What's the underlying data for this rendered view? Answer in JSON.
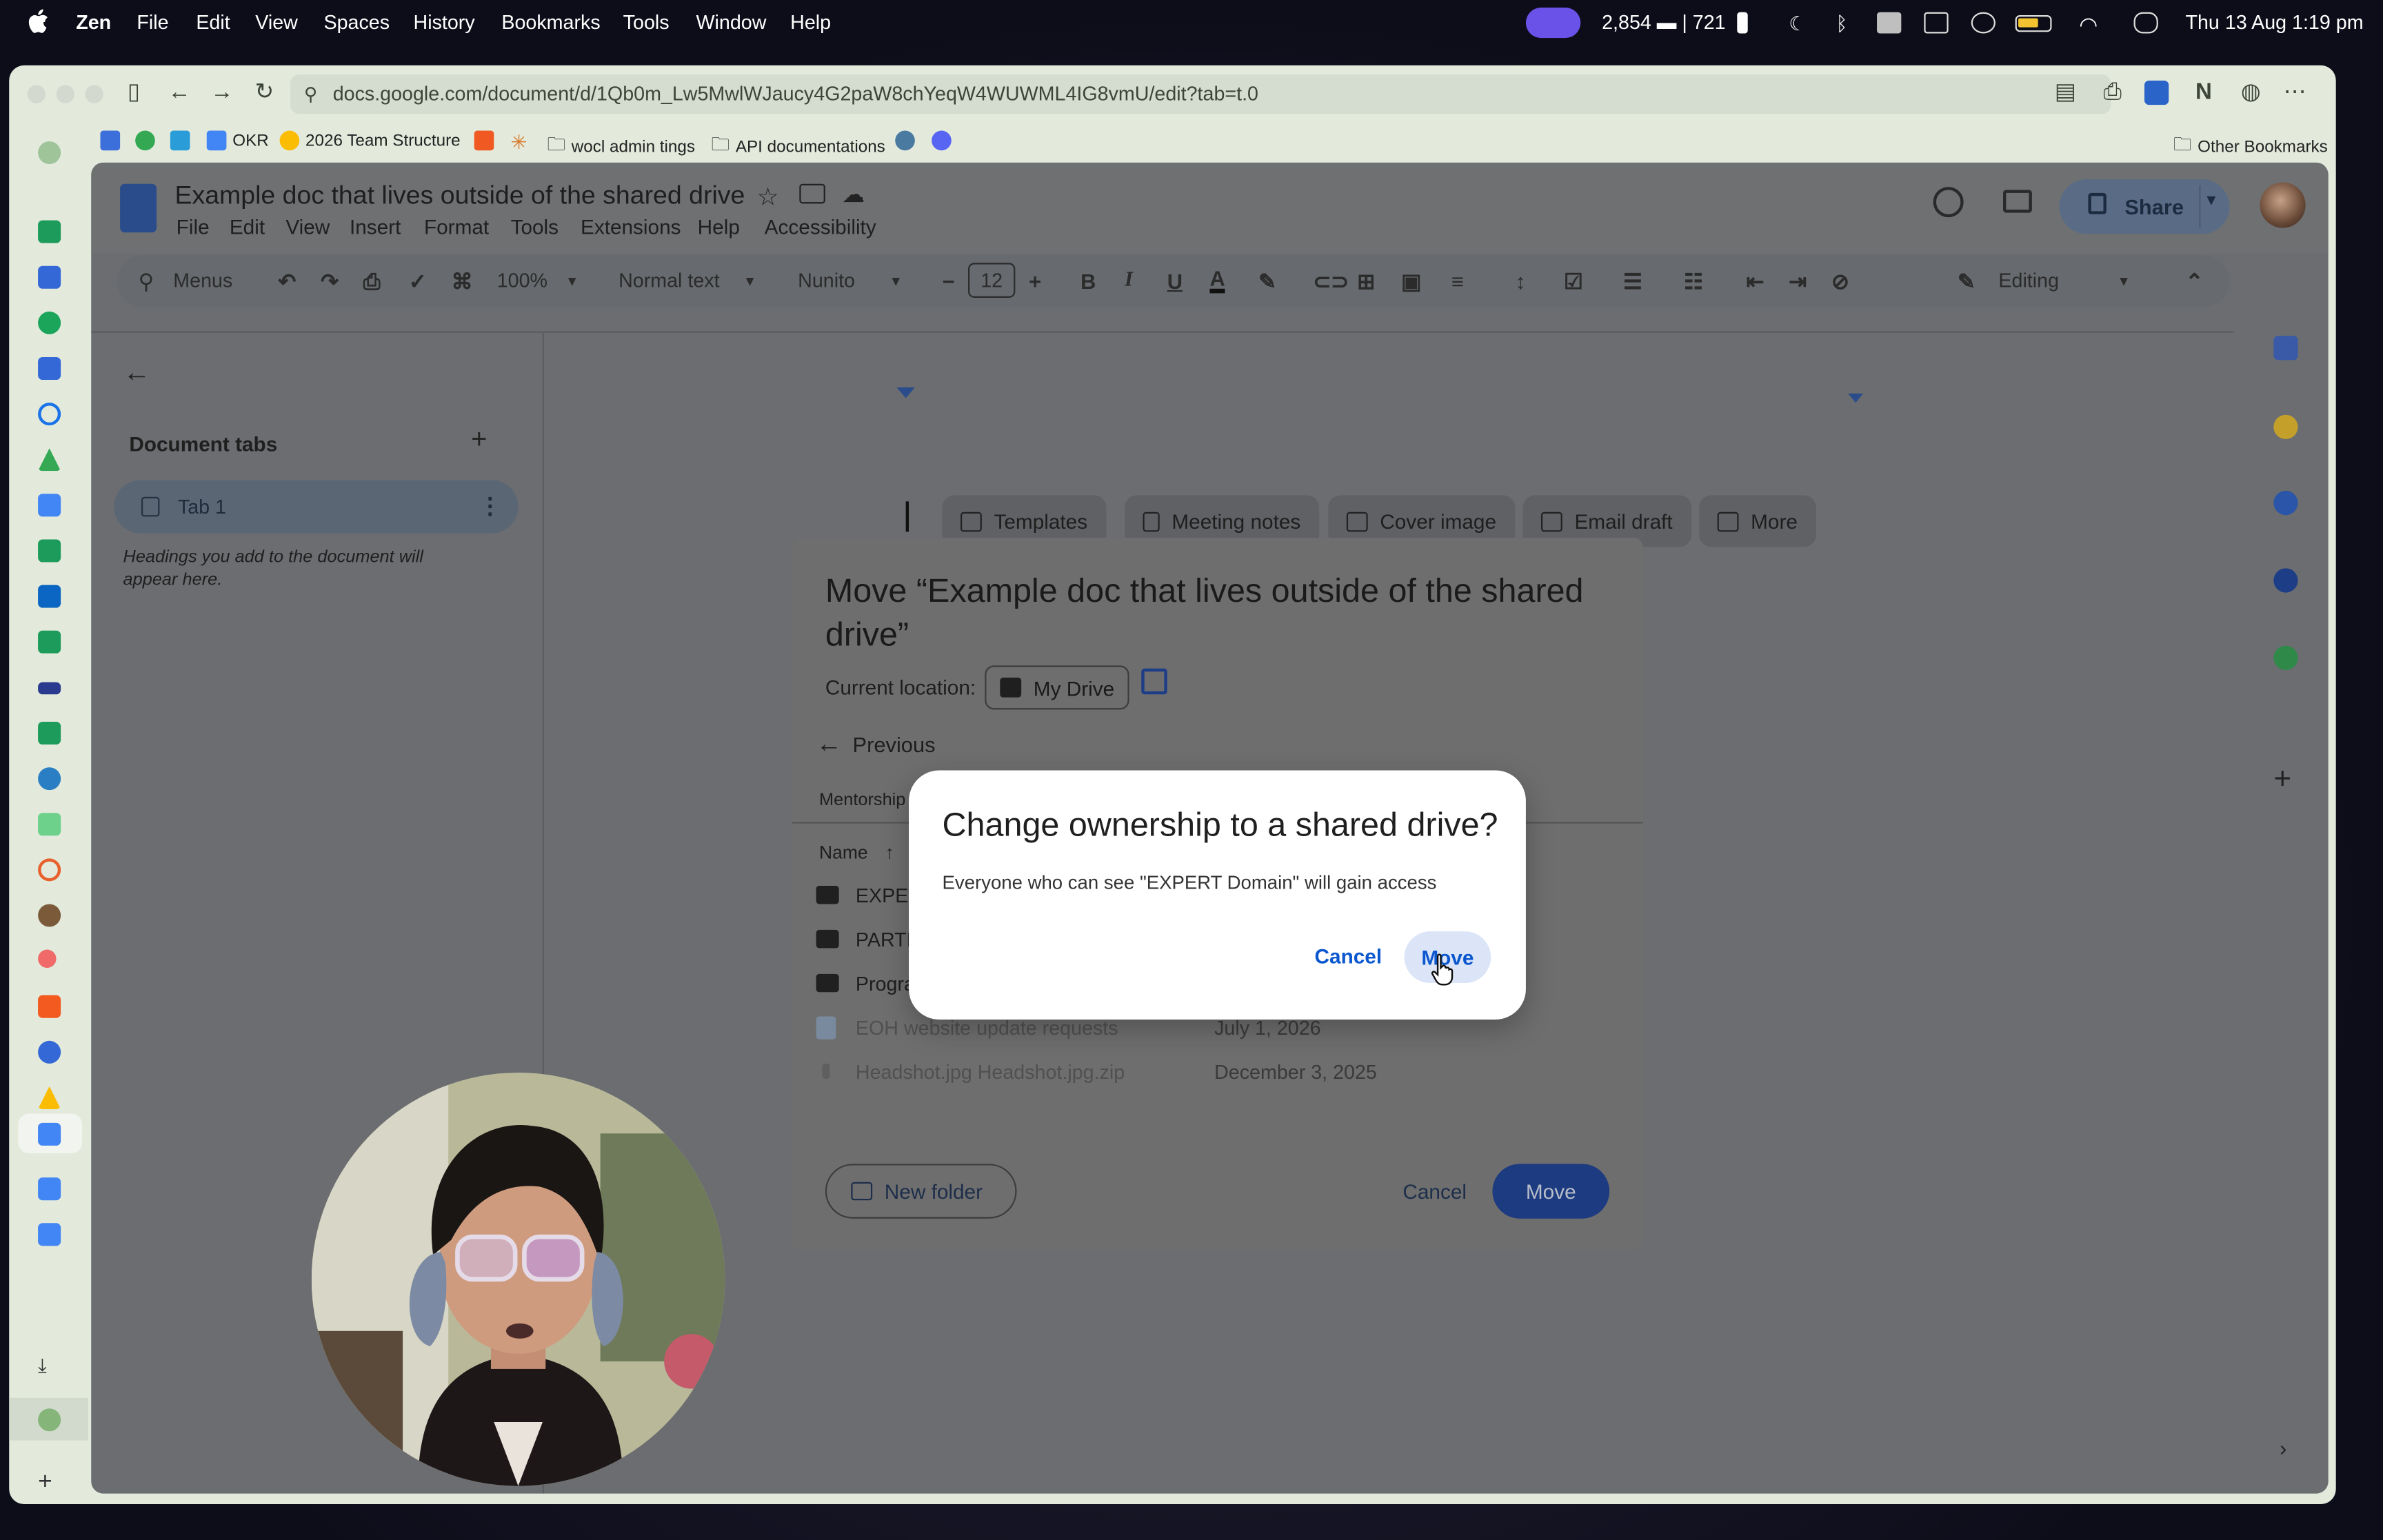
{
  "menubar": {
    "app_name": "Zen",
    "menus": [
      "File",
      "Edit",
      "View",
      "Spaces",
      "History",
      "Bookmarks",
      "Tools",
      "Window",
      "Help"
    ],
    "status_counts": "2,854 ▬ | 721",
    "datetime": "Thu 13 Aug  1:19 pm"
  },
  "browser": {
    "url": "docs.google.com/document/d/1Qb0m_Lw5MwlWJaucy4G2paW8chYeqW4WUWML4IG8vmU/edit?tab=t.0",
    "bookmarks": [
      "OKR",
      "2026 Team Structure",
      "wocl admin tings",
      "API documentations"
    ],
    "other_bookmarks": "Other Bookmarks"
  },
  "docs": {
    "title": "Example doc that lives outside of the shared drive",
    "menus": [
      "File",
      "Edit",
      "View",
      "Insert",
      "Format",
      "Tools",
      "Extensions",
      "Help",
      "Accessibility"
    ],
    "share_label": "Share",
    "toolbar": {
      "search_label": "Menus",
      "zoom": "100%",
      "style": "Normal text",
      "font": "Nunito",
      "font_size": "12",
      "mode": "Editing"
    },
    "outline": {
      "heading": "Document tabs",
      "tab_label": "Tab 1",
      "hint": "Headings you add to the document will appear here."
    },
    "chips": [
      "Templates",
      "Meeting notes",
      "Cover image",
      "Email draft",
      "More"
    ]
  },
  "move_dialog": {
    "title": "Move “Example doc that lives outside of the shared drive”",
    "current_location_label": "Current location:",
    "current_location": "My Drive",
    "previous_label": "Previous",
    "breadcrumb": "Mentorship",
    "name_header": "Name",
    "rows": [
      {
        "name": "EXPERT Domain",
        "date": ""
      },
      {
        "name": "PARTICIPANTS",
        "date": ""
      },
      {
        "name": "Programs",
        "date": ""
      },
      {
        "name": "EOH website update requests",
        "date": "July 1, 2026"
      },
      {
        "name": "Headshot.jpg Headshot.jpg.zip",
        "date": "December 3, 2025"
      }
    ],
    "new_folder_label": "New folder",
    "cancel_label": "Cancel",
    "move_label": "Move"
  },
  "confirm_dialog": {
    "title": "Change ownership to a shared drive?",
    "body": "Everyone who can see \"EXPERT Domain\" will gain access",
    "cancel_label": "Cancel",
    "move_label": "Move"
  },
  "colors": {
    "accent_blue": "#0b57d0",
    "move_button": "#1d3b80",
    "dim_overlay": "#6b6d70"
  }
}
